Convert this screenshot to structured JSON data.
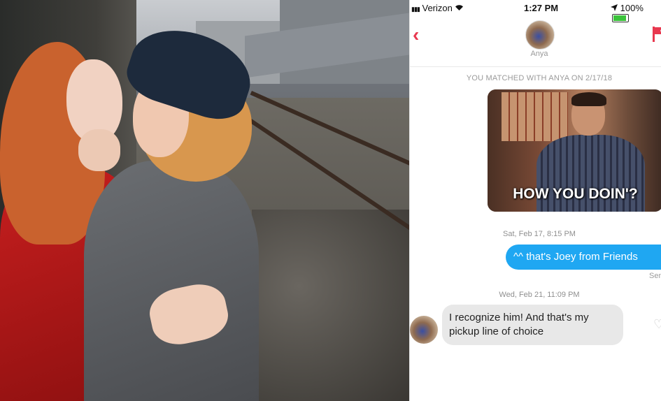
{
  "status_bar": {
    "carrier": "Verizon",
    "time": "1:27 PM",
    "battery": "100%"
  },
  "header": {
    "match_name": "Anya"
  },
  "chat": {
    "match_notice": "YOU MATCHED WITH ANYA ON 2/17/18",
    "gif_caption": "HOW YOU DOIN'?",
    "timestamp_1": "Sat, Feb 17, 8:15 PM",
    "sent_message": "^^ that's Joey from Friends",
    "sent_status": "Sent",
    "timestamp_2": "Wed, Feb 21, 11:09 PM",
    "received_message": "I recognize him! And that's my pickup line of choice"
  },
  "colors": {
    "accent": "#e8384f",
    "sent_bubble": "#1fa7f2",
    "received_bubble": "#e8e8e8"
  },
  "icons": [
    "wifi-icon",
    "location-arrow-icon",
    "battery-icon",
    "back-chevron-icon",
    "flag-icon",
    "heart-icon"
  ]
}
